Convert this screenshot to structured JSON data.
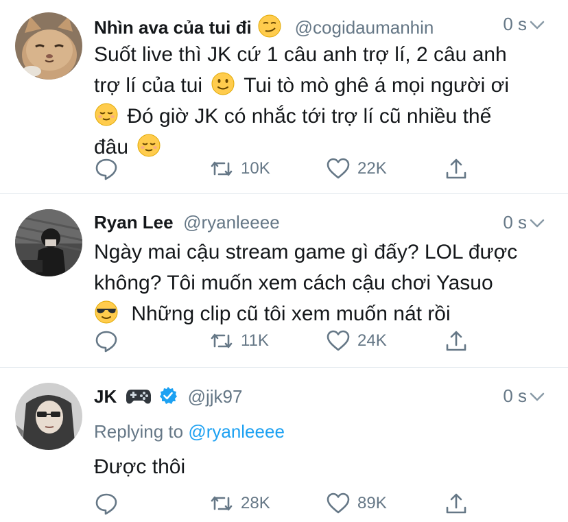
{
  "tweets": [
    {
      "name": "Nhìn ava của tui đi",
      "handle": "@cogidaumanhin",
      "time": "0 s",
      "text_lines": [
        "Suốt live thì JK cứ 1 câu anh trợ lí, 2 câu anh",
        "trợ lí của tui",
        "Tui tò mò ghê á mọi người ơi",
        "Đó giờ JK có nhắc tới trợ lí cũ nhiều thế",
        "đâu"
      ],
      "retweets": "10K",
      "likes": "22K"
    },
    {
      "name": "Ryan Lee",
      "handle": "@ryanleeee",
      "time": "0 s",
      "text_lines": [
        "Ngày mai cậu stream game gì đấy? LOL được",
        "không? Tôi muốn xem cách cậu chơi Yasuo",
        "Những clip cũ tôi xem muốn nát rồi"
      ],
      "retweets": "11K",
      "likes": "24K"
    },
    {
      "name": "JK",
      "handle": "@jjk97",
      "time": "0 s",
      "replying_prefix": "Replying to",
      "replying_handle": "@ryanleeee",
      "text_lines": [
        "Được thôi"
      ],
      "retweets": "28K",
      "likes": "89K"
    }
  ],
  "icons": {
    "reply": "reply-icon",
    "retweet": "retweet-icon",
    "like": "heart-icon",
    "share": "share-icon",
    "more": "chevron-down-icon",
    "verified": "verified-badge-icon"
  },
  "colors": {
    "link": "#1da1f2",
    "muted": "#657786",
    "verified": "#1da1f2"
  }
}
